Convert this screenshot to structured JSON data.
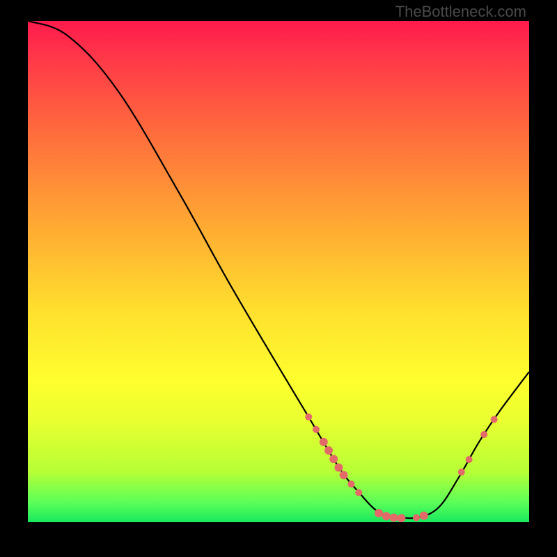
{
  "attribution": "TheBottleneck.com",
  "colors": {
    "background": "#000000",
    "curve": "#000000",
    "marker": "#e46a6a",
    "gradient_top": "#ff1a4d",
    "gradient_bottom": "#18e85e"
  },
  "chart_data": {
    "type": "line",
    "title": "",
    "xlabel": "",
    "ylabel": "",
    "xlim": [
      0,
      100
    ],
    "ylim": [
      0,
      100
    ],
    "grid": false,
    "legend": false,
    "curve": [
      {
        "x": 0,
        "y": 100
      },
      {
        "x": 8,
        "y": 97
      },
      {
        "x": 18,
        "y": 86
      },
      {
        "x": 30,
        "y": 66
      },
      {
        "x": 40,
        "y": 48
      },
      {
        "x": 50,
        "y": 31
      },
      {
        "x": 56,
        "y": 21
      },
      {
        "x": 62,
        "y": 11
      },
      {
        "x": 66,
        "y": 6
      },
      {
        "x": 70,
        "y": 2
      },
      {
        "x": 74,
        "y": 1
      },
      {
        "x": 78,
        "y": 1
      },
      {
        "x": 82,
        "y": 3
      },
      {
        "x": 86,
        "y": 9
      },
      {
        "x": 90,
        "y": 16
      },
      {
        "x": 94,
        "y": 22
      },
      {
        "x": 100,
        "y": 30
      }
    ],
    "markers": [
      {
        "x": 56,
        "y": 21,
        "r": 5
      },
      {
        "x": 57.5,
        "y": 18.5,
        "r": 5
      },
      {
        "x": 59,
        "y": 16,
        "r": 6
      },
      {
        "x": 60,
        "y": 14.3,
        "r": 6
      },
      {
        "x": 61,
        "y": 12.6,
        "r": 6
      },
      {
        "x": 62,
        "y": 10.9,
        "r": 6
      },
      {
        "x": 63,
        "y": 9.4,
        "r": 6
      },
      {
        "x": 64.5,
        "y": 7.6,
        "r": 5
      },
      {
        "x": 66,
        "y": 5.9,
        "r": 5
      },
      {
        "x": 70,
        "y": 1.8,
        "r": 6
      },
      {
        "x": 71.5,
        "y": 1.2,
        "r": 6
      },
      {
        "x": 73,
        "y": 0.9,
        "r": 6
      },
      {
        "x": 74.5,
        "y": 0.8,
        "r": 6
      },
      {
        "x": 77.5,
        "y": 0.9,
        "r": 5
      },
      {
        "x": 79,
        "y": 1.3,
        "r": 6
      },
      {
        "x": 86.5,
        "y": 10,
        "r": 5
      },
      {
        "x": 88,
        "y": 12.5,
        "r": 5
      },
      {
        "x": 91,
        "y": 17.5,
        "r": 5
      },
      {
        "x": 93,
        "y": 20.5,
        "r": 5
      }
    ]
  }
}
